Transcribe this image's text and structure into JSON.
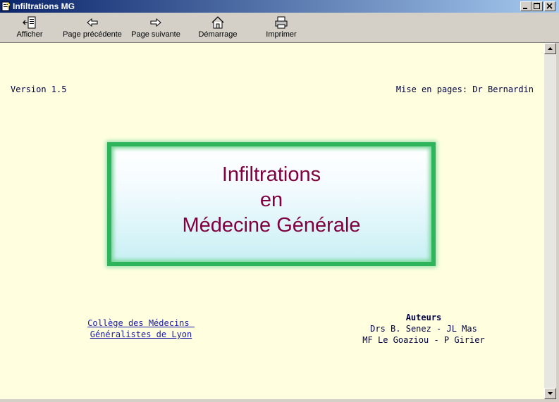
{
  "window": {
    "title": "Infiltrations MG"
  },
  "toolbar": {
    "buttons": [
      {
        "label": "Afficher",
        "icon": "show-pane-icon"
      },
      {
        "label": "Page précédente",
        "icon": "arrow-left-icon"
      },
      {
        "label": "Page suivante",
        "icon": "arrow-right-icon"
      },
      {
        "label": "Démarrage",
        "icon": "home-icon"
      },
      {
        "label": "Imprimer",
        "icon": "printer-icon"
      }
    ]
  },
  "page": {
    "version": "Version 1.5",
    "credit": "Mise en pages: Dr Bernardin",
    "banner": {
      "line1": "Infiltrations",
      "line2": "en",
      "line3": "Médecine Générale"
    },
    "college": {
      "line1": "Collège des Médecins ",
      "line2": "Généralistes de Lyon"
    },
    "authors": {
      "heading": "Auteurs",
      "line1": "Drs B. Senez - JL Mas",
      "line2": "MF Le Goaziou - P Girier"
    }
  },
  "colors": {
    "title_text": "#800040",
    "banner_border": "#2eb45a",
    "page_bg": "#ffffe0",
    "link": "#1a1aa8"
  }
}
